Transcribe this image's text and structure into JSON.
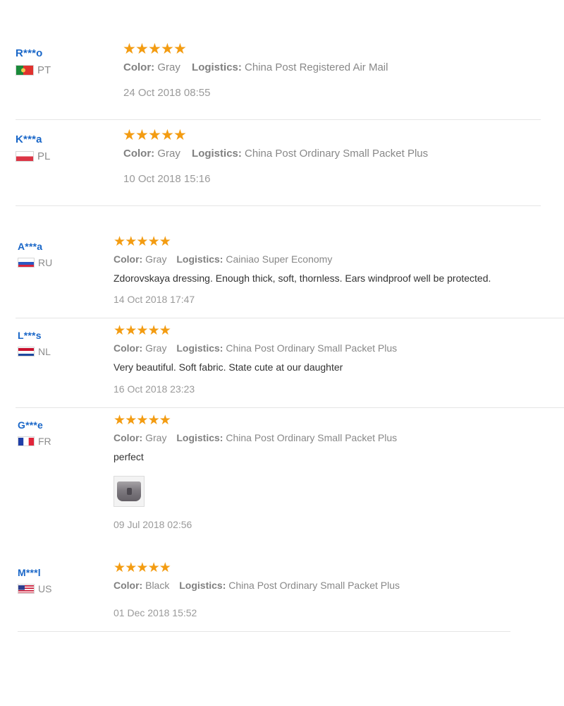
{
  "labels": {
    "color": "Color:",
    "logistics": "Logistics:"
  },
  "star_color": "#f39c12",
  "name_color": "#1a67c8",
  "reviews": [
    {
      "name": "R***o",
      "country": "PT",
      "rating": 5,
      "color": "Gray",
      "logistics": "China Post Registered Air Mail",
      "comment": "",
      "date": "24 Oct 2018 08:55"
    },
    {
      "name": "K***a",
      "country": "PL",
      "rating": 5,
      "color": "Gray",
      "logistics": "China Post Ordinary Small Packet Plus",
      "comment": "",
      "date": "10 Oct 2018 15:16"
    },
    {
      "name": "A***a",
      "country": "RU",
      "rating": 5,
      "color": "Gray",
      "logistics": "Cainiao Super Economy",
      "comment": "Zdorovskaya dressing. Enough thick, soft, thornless. Ears windproof well be protected.",
      "date": "14 Oct 2018 17:47"
    },
    {
      "name": "L***s",
      "country": "NL",
      "rating": 5,
      "color": "Gray",
      "logistics": "China Post Ordinary Small Packet Plus",
      "comment": "Very beautiful. Soft fabric. State cute at our daughter",
      "date": "16 Oct 2018 23:23"
    },
    {
      "name": "G***e",
      "country": "FR",
      "rating": 5,
      "color": "Gray",
      "logistics": "China Post Ordinary Small Packet Plus",
      "comment": "perfect",
      "has_photo": true,
      "date": "09 Jul 2018 02:56"
    },
    {
      "name": "M***l",
      "country": "US",
      "rating": 5,
      "color": "Black",
      "logistics": "China Post Ordinary Small Packet Plus",
      "comment": "",
      "date": "01 Dec 2018 15:52"
    }
  ]
}
